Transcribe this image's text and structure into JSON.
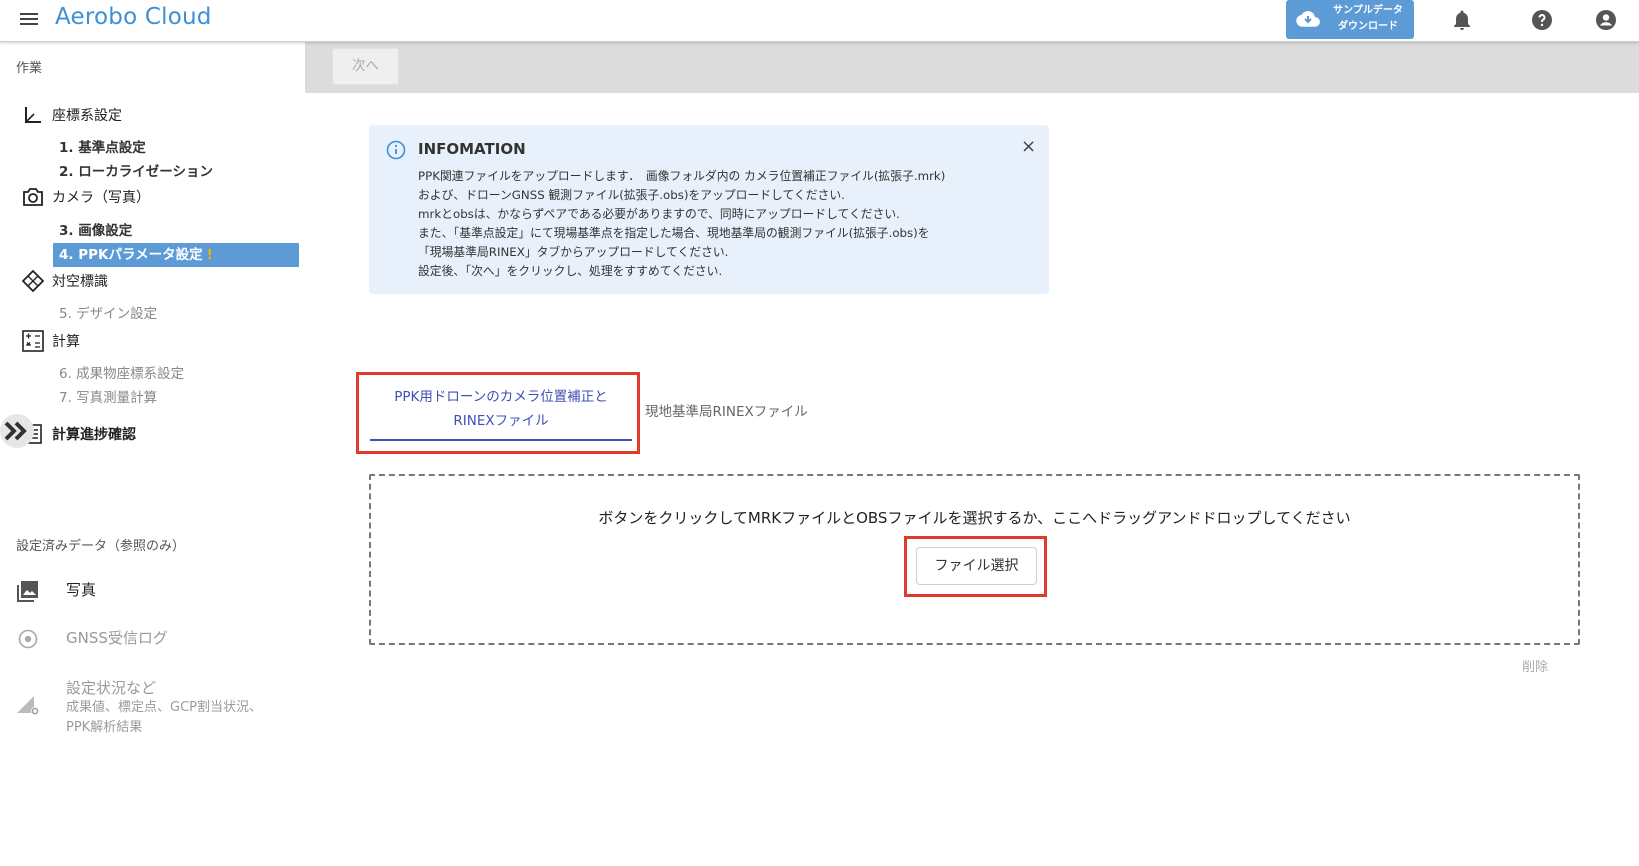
{
  "header": {
    "title": "Aerobo Cloud",
    "sample_download": [
      "サンプルデータ",
      "ダウンロード"
    ]
  },
  "sidebar": {
    "section_work": "作業",
    "groups": [
      {
        "label": "座標系設定",
        "icon": "axes-icon"
      },
      {
        "label": "カメラ（写真）",
        "icon": "camera-icon"
      },
      {
        "label": "対空標識",
        "icon": "diamond-icon"
      },
      {
        "label": "計算",
        "icon": "calculator-icon"
      },
      {
        "label": "計算進捗確認",
        "icon": "list-icon"
      }
    ],
    "steps": {
      "s1": "1. 基準点設定",
      "s2": "2. ローカライゼーション",
      "s3": "3. 画像設定",
      "s4": "4. PPKパラメータ設定",
      "s4_warning": "!",
      "s5": "5. デザイン設定",
      "s6": "6. 成果物座標系設定",
      "s7": "7. 写真測量計算"
    },
    "section_reference": "設定済みデータ（参照のみ）",
    "reference_items": {
      "photo": "写真",
      "gnss": "GNSS受信ログ",
      "settings": "設定状況など",
      "settings_sub1": "成果値、標定点、GCP割当状況、",
      "settings_sub2": "PPK解析結果"
    }
  },
  "toolbar": {
    "next_label": "次へ"
  },
  "info": {
    "title": "INFOMATION",
    "close": "×",
    "lines": [
      "PPK関連ファイルをアップロードします．　画像フォルダ内の カメラ位置補正ファイル(拡張子.mrk)",
      "および、ドローンGNSS 観測ファイル(拡張子.obs)をアップロードしてください.",
      "mrkとobsは、かならずペアである必要がありますので、同時にアップロードしてください.",
      "また、「基準点設定」にて現場基準点を指定した場合、現地基準局の観測ファイル(拡張子.obs)を",
      "「現場基準局RINEX」タブからアップロードしてください.",
      "設定後、「次へ」をクリックし、処理をすすめてください."
    ]
  },
  "tabs": {
    "tab1_line1": "PPK用ドローンのカメラ位置補正と",
    "tab1_line2": "RINEXファイル",
    "tab2": "現地基準局RINEXファイル"
  },
  "dropzone": {
    "instruction": "ボタンをクリックしてMRKファイルとOBSファイルを選択するか、ここへドラッグアンドドロップしてください",
    "file_select": "ファイル選択",
    "delete": "削除"
  },
  "colors": {
    "brand": "#3d8fd6",
    "active_step": "#5c9bd6",
    "tab_active": "#3f51b5",
    "highlight": "#e03a2a",
    "info_bg": "#e8f1fb"
  }
}
